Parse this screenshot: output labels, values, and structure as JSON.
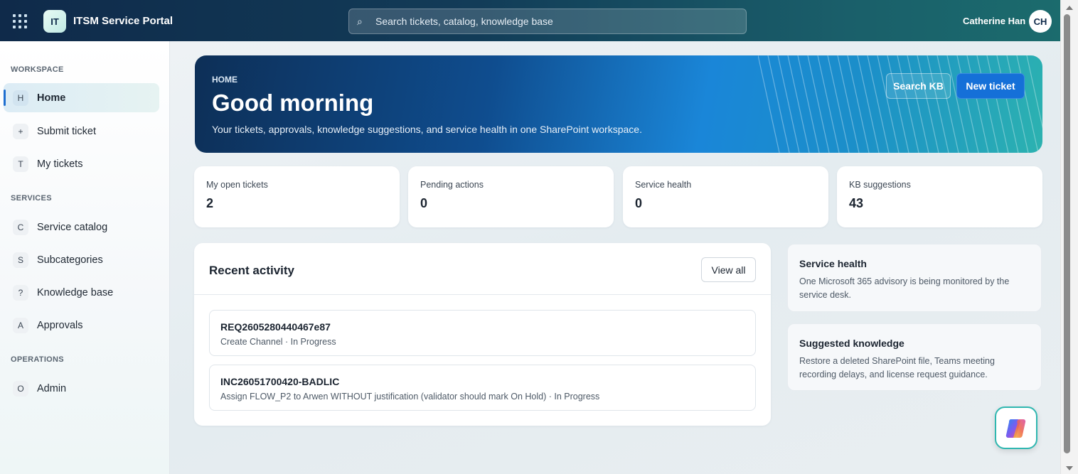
{
  "header": {
    "app_logo_text": "IT",
    "app_title": "ITSM Service Portal",
    "search_placeholder": "Search tickets, catalog, knowledge base",
    "user_name": "Catherine Han",
    "user_initials": "CH"
  },
  "sidebar": {
    "sections": [
      {
        "label": "WORKSPACE"
      },
      {
        "label": "SERVICES"
      },
      {
        "label": "OPERATIONS"
      }
    ],
    "items": [
      {
        "badge": "H",
        "label": "Home",
        "active": true
      },
      {
        "badge": "+",
        "label": "Submit ticket"
      },
      {
        "badge": "T",
        "label": "My tickets"
      },
      {
        "badge": "C",
        "label": "Service catalog"
      },
      {
        "badge": "S",
        "label": "Subcategories"
      },
      {
        "badge": "?",
        "label": "Knowledge base"
      },
      {
        "badge": "A",
        "label": "Approvals"
      },
      {
        "badge": "O",
        "label": "Admin"
      }
    ]
  },
  "hero": {
    "kicker": "HOME",
    "title": "Good morning",
    "subtitle": "Your tickets, approvals, knowledge suggestions, and service health in one SharePoint workspace.",
    "search_kb_label": "Search KB",
    "new_ticket_label": "New ticket"
  },
  "stats": [
    {
      "label": "My open tickets",
      "value": "2"
    },
    {
      "label": "Pending actions",
      "value": "0"
    },
    {
      "label": "Service health",
      "value": "0"
    },
    {
      "label": "KB suggestions",
      "value": "43"
    }
  ],
  "activity": {
    "title": "Recent activity",
    "view_all_label": "View all",
    "items": [
      {
        "id": "REQ2605280440467e87",
        "desc": "Create Channel · In Progress"
      },
      {
        "id": "INC26051700420-BADLIC",
        "desc": "Assign FLOW_P2 to Arwen WITHOUT justification (validator should mark On Hold) · In Progress"
      }
    ]
  },
  "side_cards": [
    {
      "title": "Service health",
      "text": "One Microsoft 365 advisory is being monitored by the service desk."
    },
    {
      "title": "Suggested knowledge",
      "text": "Restore a deleted SharePoint file, Teams meeting recording delays, and license request guidance."
    }
  ],
  "icons": {
    "app_launcher": "waffle-icon",
    "search": "search-icon",
    "copilot": "copilot-icon"
  },
  "colors": {
    "primary": "#1570d8",
    "accent_teal": "#2fb7b0",
    "header_dark": "#0f2a4a"
  }
}
